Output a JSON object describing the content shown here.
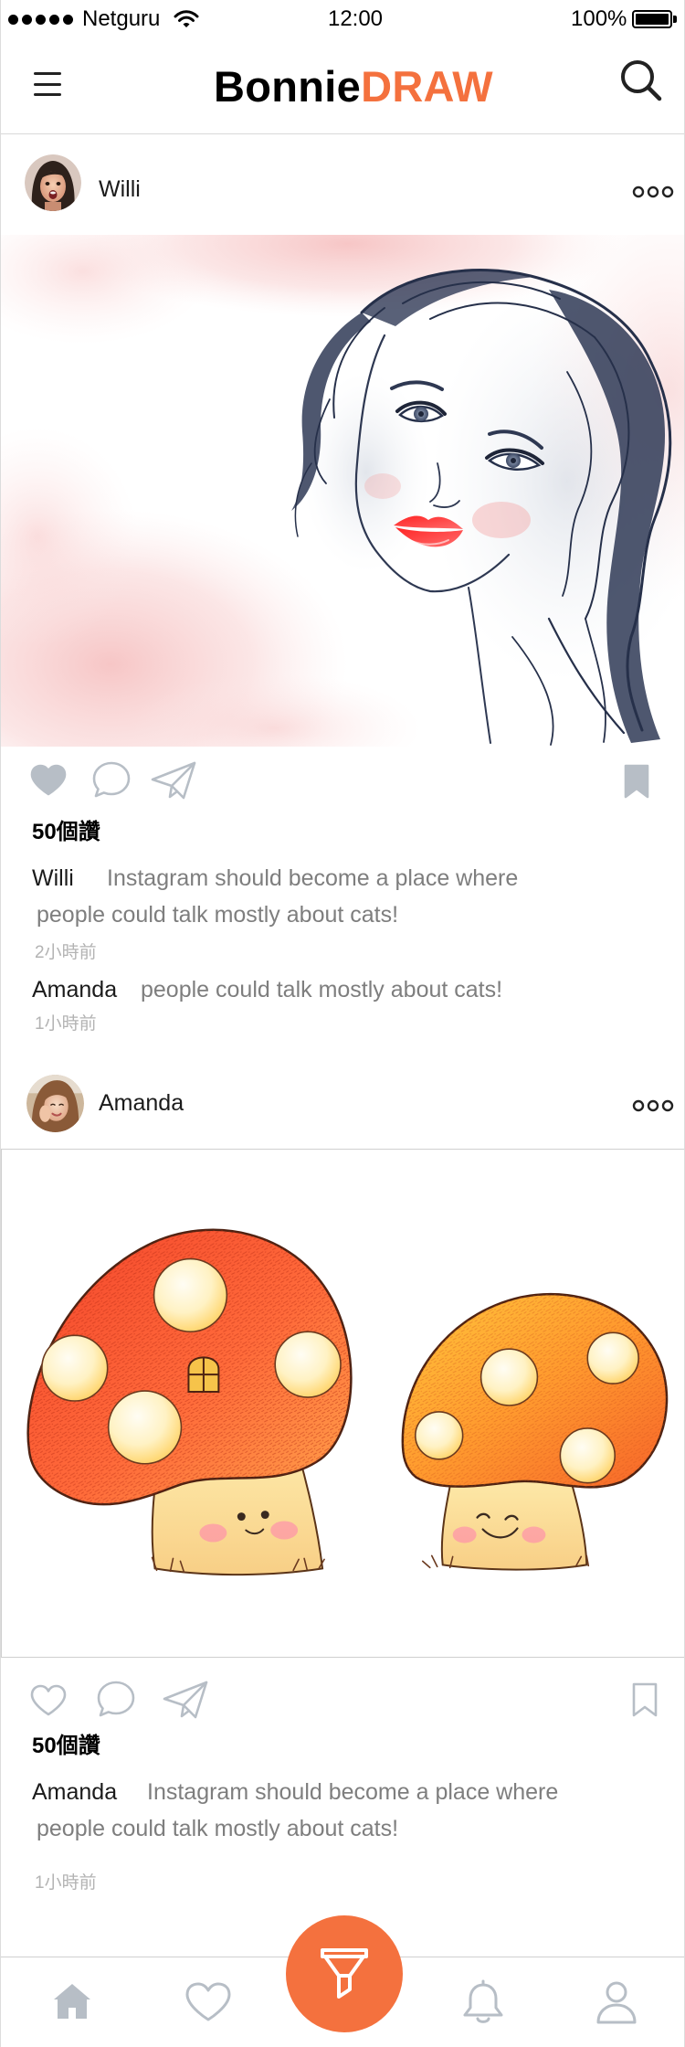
{
  "status_bar": {
    "signal_icon": "signal-dots-icon",
    "carrier": "Netguru",
    "wifi_icon": "wifi-icon",
    "time": "12:00",
    "battery_percent": "100%",
    "battery_icon": "battery-icon"
  },
  "nav": {
    "menu_icon": "menu-icon",
    "logo_part_1": "Bonnie",
    "logo_part_2": "DRAW",
    "search_icon": "search-icon"
  },
  "colors": {
    "accent": "#F4713E",
    "icon": "#B7BEC6",
    "text": "#1B1B1B",
    "comment_text": "#7E7E7E",
    "timestamp": "#B3B3B3",
    "divider": "#D9D9D9"
  },
  "posts": [
    {
      "user": "Willi",
      "more_icon": "more-dots-icon",
      "liked": true,
      "saved": true,
      "likes": "50個讚",
      "comments": [
        {
          "user": "Willi",
          "lines": [
            "Instagram should become a place where",
            "people could talk mostly about cats!"
          ],
          "time": "2小時前"
        },
        {
          "user": "Amanda",
          "lines": [
            "people could talk mostly about cats!"
          ],
          "time": "1小時前"
        }
      ]
    },
    {
      "user": "Amanda",
      "more_icon": "more-dots-icon",
      "liked": false,
      "saved": false,
      "likes": "50個讚",
      "comments": [
        {
          "user": "Amanda",
          "lines": [
            "Instagram should become a place where",
            "people could talk mostly about cats!"
          ],
          "time": "1小時前"
        }
      ]
    }
  ],
  "tab_bar": {
    "items": [
      {
        "icon": "home-icon",
        "active": true
      },
      {
        "icon": "heart-icon",
        "active": false
      },
      {
        "icon": "draw-icon",
        "active": false
      },
      {
        "icon": "bell-icon",
        "active": false
      },
      {
        "icon": "profile-icon",
        "active": false
      }
    ]
  }
}
